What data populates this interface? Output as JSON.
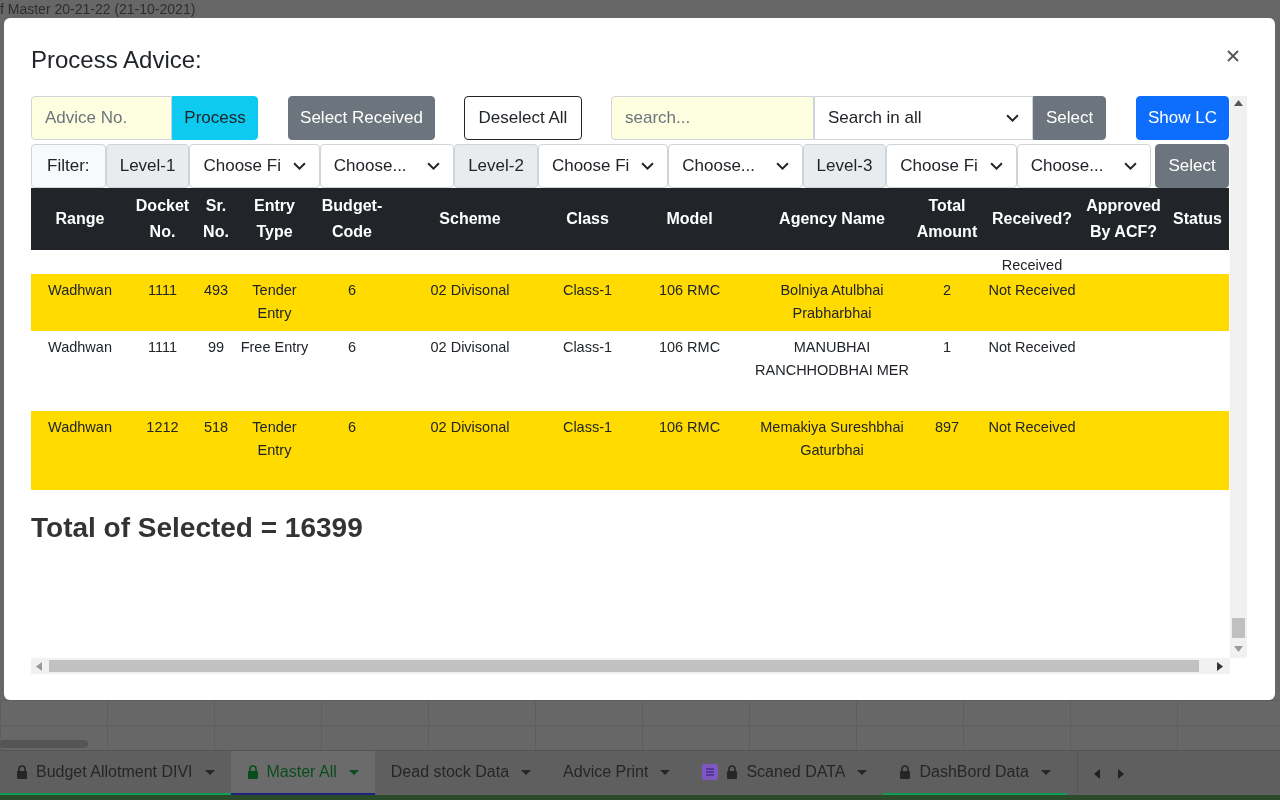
{
  "document_title": "f Master 20-21-22 (21-10-2021)",
  "modal": {
    "title": "Process Advice:",
    "toolbar": {
      "advice_field": {
        "placeholder": "Advice No."
      },
      "process_button": "Process",
      "select_received_button": "Select Received",
      "deselect_all_button": "Deselect All",
      "search_field": {
        "placeholder": "search..."
      },
      "search_scope": "Search in all",
      "select_button": "Select",
      "show_lc_button": "Show LC"
    },
    "filter": {
      "label": "Filter:",
      "levels": [
        {
          "label": "Level-1",
          "field": "Choose Fi",
          "value": "Choose..."
        },
        {
          "label": "Level-2",
          "field": "Choose Fi",
          "value": "Choose..."
        },
        {
          "label": "Level-3",
          "field": "Choose Fi",
          "value": "Choose..."
        }
      ],
      "select_button": "Select"
    },
    "table": {
      "columns": [
        "Range",
        "Docket No.",
        "Sr. No.",
        "Entry Type",
        "Budget-Code",
        "Scheme",
        "Class",
        "Model",
        "Agency Name",
        "Total Amount",
        "Received?",
        "Approved By ACF?",
        "Status"
      ],
      "partial_row": {
        "received": "Received"
      },
      "rows": [
        {
          "selected": true,
          "cells": [
            "Wadhwan",
            "1111",
            "493",
            "Tender Entry",
            "6",
            "02 Divisonal",
            "Class-1",
            "106 RMC",
            "Bolniya Atulbhai Prabharbhai",
            "2",
            "Not Received"
          ]
        },
        {
          "selected": false,
          "cells": [
            "Wadhwan",
            "1111",
            "99",
            "Free Entry",
            "6",
            "02 Divisonal",
            "Class-1",
            "106 RMC",
            "MANUBHAI RANCHHODBHAI MER",
            "1",
            "Not Received"
          ]
        },
        {
          "selected": true,
          "cells": [
            "Wadhwan",
            "1212",
            "518",
            "Tender Entry",
            "6",
            "02 Divisonal",
            "Class-1",
            "106 RMC",
            "Memakiya Sureshbhai Gaturbhai",
            "897",
            "Not Received"
          ]
        }
      ]
    },
    "total": "Total of Selected = 16399"
  },
  "sheet_tabs": [
    {
      "label": "Budget Allotment DIVI",
      "selected": false,
      "locked": true,
      "form": false,
      "color": "#0f9d58"
    },
    {
      "label": "Master All",
      "selected": true,
      "locked": true,
      "form": false,
      "color": "#1a237e"
    },
    {
      "label": "Dead stock Data",
      "selected": false,
      "locked": false,
      "form": false
    },
    {
      "label": "Advice Print",
      "selected": false,
      "locked": false,
      "form": false
    },
    {
      "label": "Scaned DATA",
      "selected": false,
      "locked": true,
      "form": true
    },
    {
      "label": "DashBord Data",
      "selected": false,
      "locked": true,
      "form": false,
      "color": "#0f9d58"
    }
  ]
}
